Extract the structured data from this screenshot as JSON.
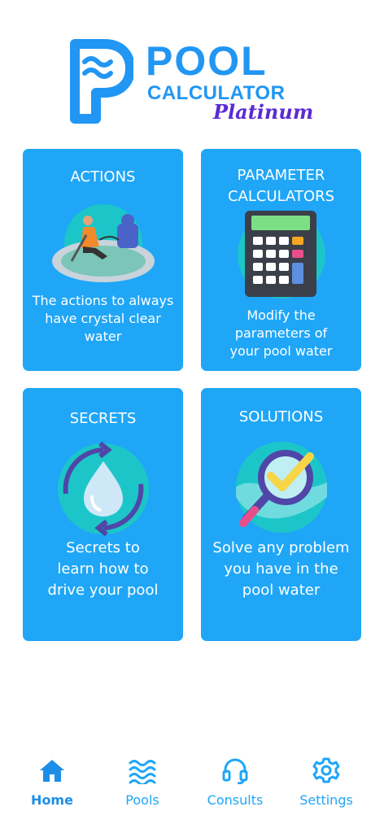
{
  "logo": {
    "title": "POOL",
    "subtitle": "CALCULATOR",
    "edition": "Platinum"
  },
  "cards": [
    {
      "title": "ACTIONS",
      "description": "The actions to always have crystal clear water",
      "icon": "pool-cleaner-icon"
    },
    {
      "title": "PARAMETER CALCULATORS",
      "description": "Modify the parameters of your pool water",
      "icon": "calculator-icon"
    },
    {
      "title": "SECRETS",
      "description": "Secrets to learn how to drive your pool",
      "icon": "water-drop-cycle-icon"
    },
    {
      "title": "SOLUTIONS",
      "description": "Solve any problem you have in the pool water",
      "icon": "magnifier-check-icon"
    }
  ],
  "nav": [
    {
      "label": "Home",
      "icon": "home-icon",
      "active": true
    },
    {
      "label": "Pools",
      "icon": "waves-icon",
      "active": false
    },
    {
      "label": "Consults",
      "icon": "headset-icon",
      "active": false
    },
    {
      "label": "Settings",
      "icon": "gear-icon",
      "active": false
    }
  ],
  "colors": {
    "primary": "#1fa6f7",
    "logo_blue": "#2196f3",
    "logo_purple": "#5b2bd1",
    "illustration_circle": "#1cc6c8"
  }
}
